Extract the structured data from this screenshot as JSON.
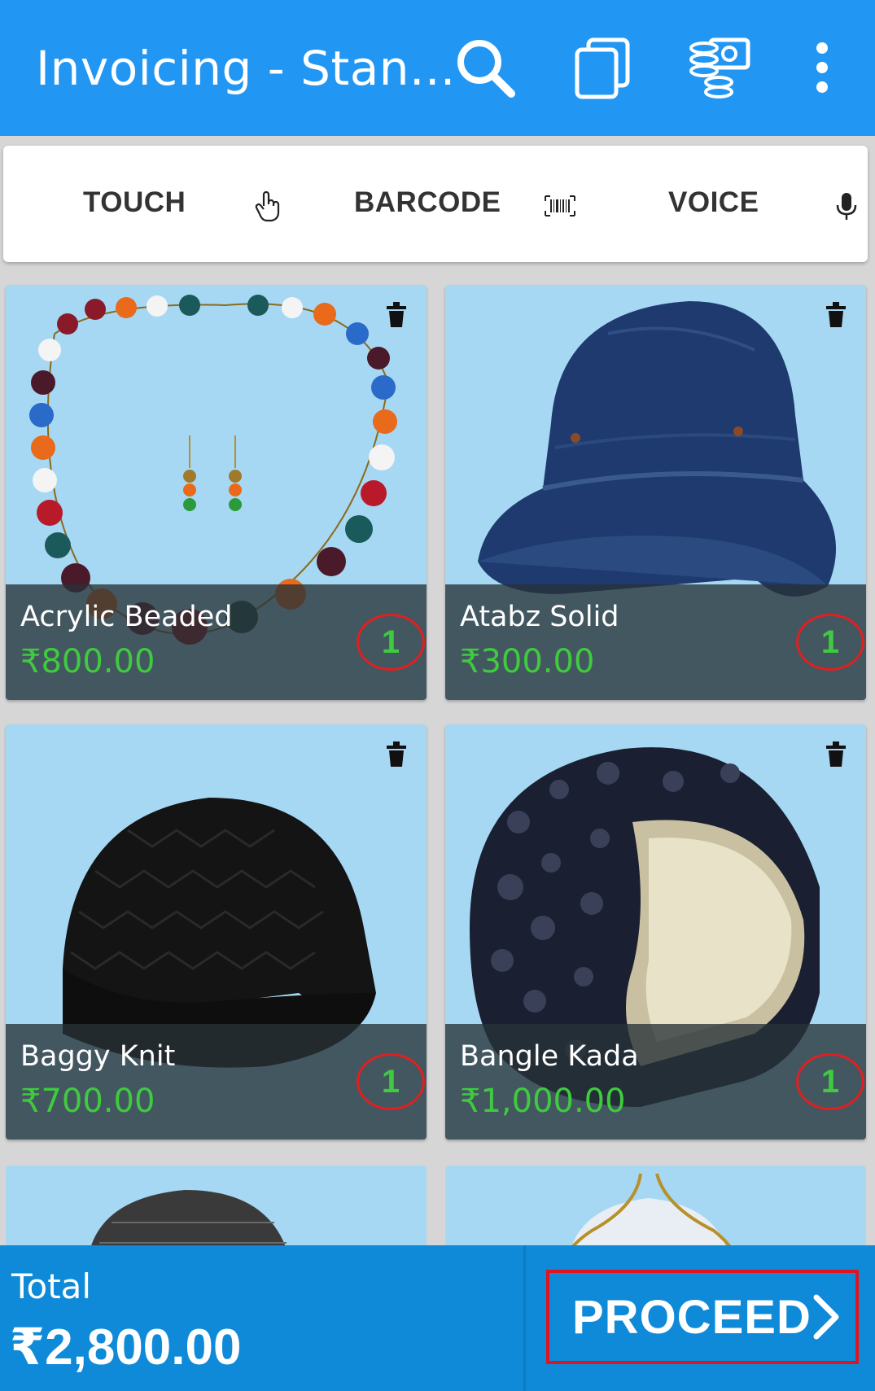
{
  "header": {
    "title": "Invoicing - Stan...",
    "icons": [
      "search-icon",
      "copy-icon",
      "coins-cash-icon",
      "more-vert-icon"
    ]
  },
  "modes": [
    {
      "label": "TOUCH",
      "icon": "touch-hand-icon"
    },
    {
      "label": "BARCODE",
      "icon": "barcode-icon"
    },
    {
      "label": "VOICE",
      "icon": "microphone-icon"
    }
  ],
  "items": [
    {
      "name": "Acrylic Beaded",
      "price": "₹800.00",
      "qty": "1"
    },
    {
      "name": "Atabz Solid",
      "price": "₹300.00",
      "qty": "1"
    },
    {
      "name": "Baggy Knit",
      "price": "₹700.00",
      "qty": "1"
    },
    {
      "name": "Bangle Kada",
      "price": "₹1,000.00",
      "qty": "1"
    }
  ],
  "footer": {
    "total_label": "Total",
    "total_value": "₹2,800.00",
    "proceed_label": "PROCEED"
  },
  "colors": {
    "appbar": "#2196f3",
    "footer": "#0e8ad8",
    "price_green": "#3fca3f",
    "highlight_red": "#e02020"
  }
}
